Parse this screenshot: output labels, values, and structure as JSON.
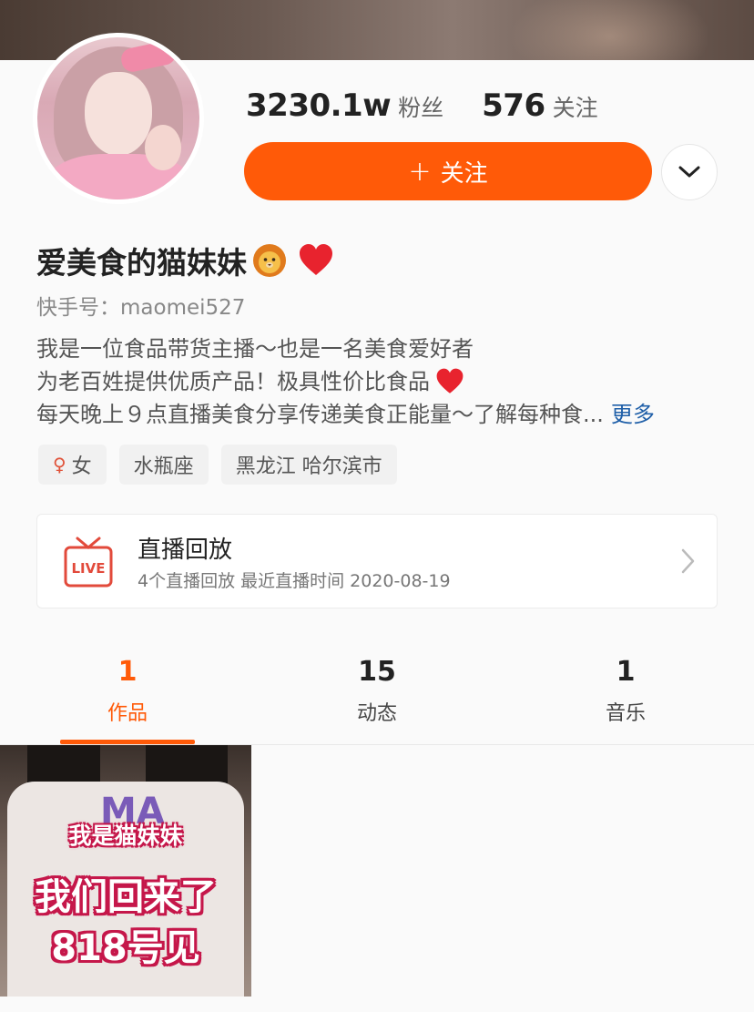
{
  "profile": {
    "followers_count": "3230.1w",
    "followers_label": "粉丝",
    "following_count": "576",
    "following_label": "关注",
    "follow_button_plus": "+",
    "follow_button_label": "关注",
    "nickname": "爱美食的猫妹妹",
    "account_label": "快手号：",
    "account_id": "maomei527",
    "bio_line1": "我是一位食品带货主播～也是一名美食爱好者",
    "bio_line2": "为老百姓提供优质产品！极具性价比食品",
    "bio_line3": "每天晚上９点直播美食分享传递美食正能量～了解每种食...",
    "bio_more": "更多",
    "tags": {
      "gender_symbol": "♀",
      "gender": "女",
      "zodiac": "水瓶座",
      "location": "黑龙江 哈尔滨市"
    }
  },
  "live_replay": {
    "title": "直播回放",
    "subtitle": "4个直播回放 最近直播时间 2020-08-19",
    "icon_text": "LIVE"
  },
  "tabs": [
    {
      "count": "1",
      "label": "作品"
    },
    {
      "count": "15",
      "label": "动态"
    },
    {
      "count": "1",
      "label": "音乐"
    }
  ],
  "works": [
    {
      "caption1": "我是猫妹妹",
      "caption2": "我们回来了",
      "caption3": "818号见",
      "shirt_print": "MA"
    }
  ],
  "colors": {
    "accent": "#ff5a08",
    "link": "#1f5fa8",
    "heart": "#e8232e"
  },
  "icons": {
    "nickname_emoji_1": "lion-face-icon",
    "nickname_emoji_2": "red-heart-icon",
    "bio_emoji": "red-heart-icon",
    "more": "chevron-down-icon",
    "live": "live-tv-icon",
    "card_arrow": "chevron-right-icon"
  }
}
